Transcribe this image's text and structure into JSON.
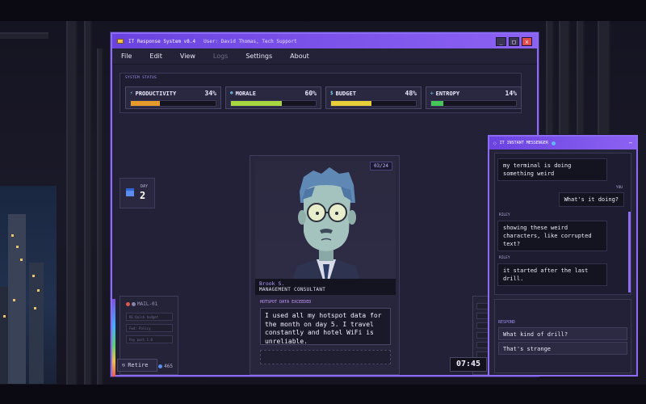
{
  "window": {
    "title": "IT Response System v8.4",
    "user": "User: David Thomas, Tech Support",
    "controls": [
      "_",
      "□",
      "x"
    ]
  },
  "menu": [
    "File",
    "Edit",
    "View",
    "Logs",
    "Settings",
    "About"
  ],
  "status": {
    "title": "SYSTEM STATUS",
    "stats": [
      {
        "label": "PRODUCTIVITY",
        "icon": "lightning-icon",
        "percent": "34%",
        "value": 0.34,
        "color": "#e49b2c"
      },
      {
        "label": "MORALE",
        "icon": "person-icon",
        "percent": "60%",
        "value": 0.6,
        "color": "#a8d640"
      },
      {
        "label": "BUDGET",
        "icon": "dollar-icon",
        "percent": "48%",
        "value": 0.48,
        "color": "#e8cf3a"
      },
      {
        "label": "ENTROPY",
        "icon": "chaos-icon",
        "percent": "14%",
        "value": 0.14,
        "color": "#45c75a"
      }
    ]
  },
  "day": {
    "label": "DAY",
    "number": "2"
  },
  "character": {
    "counter": "03/24",
    "name": "Brook S.",
    "role": "MANAGEMENT CONSULTANT",
    "issue_label": "HOTSPOT DATA EXCEEDED",
    "dialogue": "I used all my hotspot data for the month on day 5. I travel constantly and hotel WiFi is unreliable."
  },
  "mail": {
    "title": "MAIL-01",
    "rows": [
      "RE:Quick budget",
      "Fwd: Policy",
      "Pay past 1.0"
    ],
    "count": "465"
  },
  "footer": {
    "retire": "Retire",
    "clock": "07:45"
  },
  "im": {
    "title": "IT INSTANT MESSENGER",
    "messages": [
      {
        "from": "",
        "text": "my terminal is doing something weird"
      },
      {
        "from": "YOU",
        "text": "What's it doing?"
      },
      {
        "from": "RILEY",
        "text": "showing these weird characters, like corrupted text?"
      },
      {
        "from": "RILEY",
        "text": "it started after the last drill."
      }
    ],
    "respond_label": "RESPOND",
    "options": [
      "What kind of drill?",
      "That's strange"
    ]
  }
}
